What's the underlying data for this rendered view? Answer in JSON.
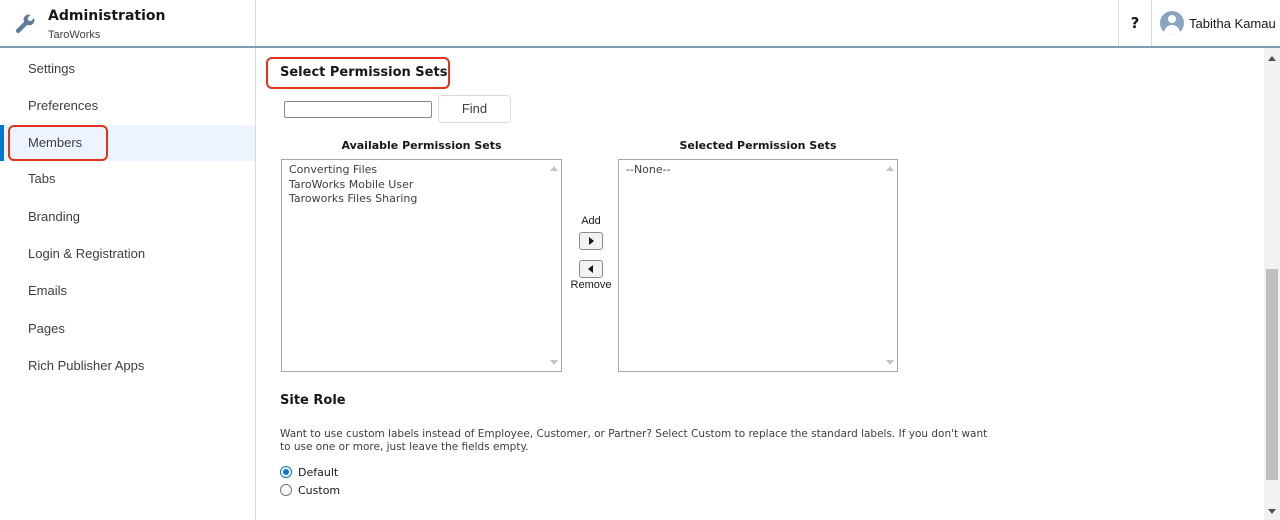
{
  "header": {
    "app_icon": "wrench-icon",
    "title": "Administration",
    "subtitle": "TaroWorks",
    "help_label": "?",
    "user_name": "Tabitha Kamau",
    "user_icon": "user-avatar-icon"
  },
  "sidebar": {
    "items": [
      {
        "label": "Settings",
        "active": false
      },
      {
        "label": "Preferences",
        "active": false
      },
      {
        "label": "Members",
        "active": true
      },
      {
        "label": "Tabs",
        "active": false
      },
      {
        "label": "Branding",
        "active": false
      },
      {
        "label": "Login & Registration",
        "active": false
      },
      {
        "label": "Emails",
        "active": false
      },
      {
        "label": "Pages",
        "active": false
      },
      {
        "label": "Rich Publisher Apps",
        "active": false
      }
    ]
  },
  "permission_sets": {
    "title": "Select Permission Sets",
    "search_value": "",
    "find_label": "Find",
    "available_label": "Available Permission Sets",
    "available_items": [
      "Converting Files",
      "TaroWorks Mobile User",
      "Taroworks Files Sharing"
    ],
    "add_label": "Add",
    "remove_label": "Remove",
    "selected_label": "Selected Permission Sets",
    "selected_items": [
      "--None--"
    ]
  },
  "site_role": {
    "title": "Site Role",
    "description": "Want to use custom labels instead of Employee, Customer, or Partner? Select Custom to replace the standard labels. If you don't want to use one or more, just leave the fields empty.",
    "options": [
      {
        "label": "Default",
        "checked": true
      },
      {
        "label": "Custom",
        "checked": false
      }
    ]
  },
  "colors": {
    "accent": "#0176d3",
    "highlight": "#e0321c",
    "header_border": "#7f9ab1"
  }
}
